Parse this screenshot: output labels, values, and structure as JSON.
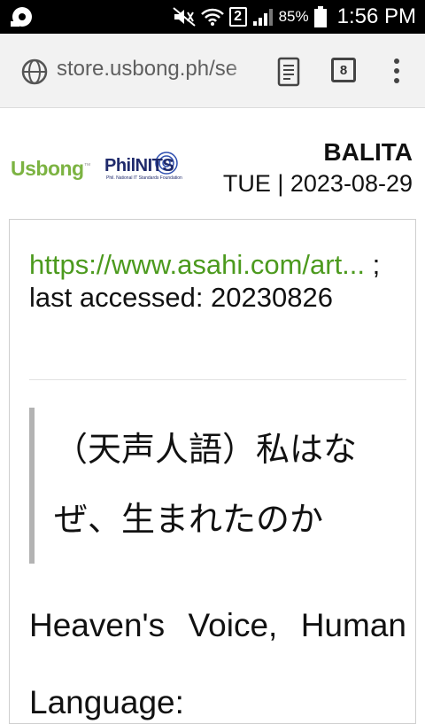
{
  "status_bar": {
    "battery_percent": "85%",
    "sim_slot": "2",
    "time": "1:56 PM"
  },
  "browser": {
    "url": "store.usbong.ph/se",
    "tab_count": "8"
  },
  "header": {
    "logo_usbong": "Usbong",
    "logo_philnits": "PhilNITS",
    "logo_philnits_sub": "Phil. National IT Standards Foundation",
    "section": "BALITA",
    "date": "TUE | 2023-08-29"
  },
  "article": {
    "source_link": "https://www.asahi.com/art...",
    "source_suffix": " ; last accessed: 20230826",
    "quote_title": "（天声人語）私はなぜ、生まれたのか",
    "body_start": "Heaven's Voice, Human Language:"
  }
}
